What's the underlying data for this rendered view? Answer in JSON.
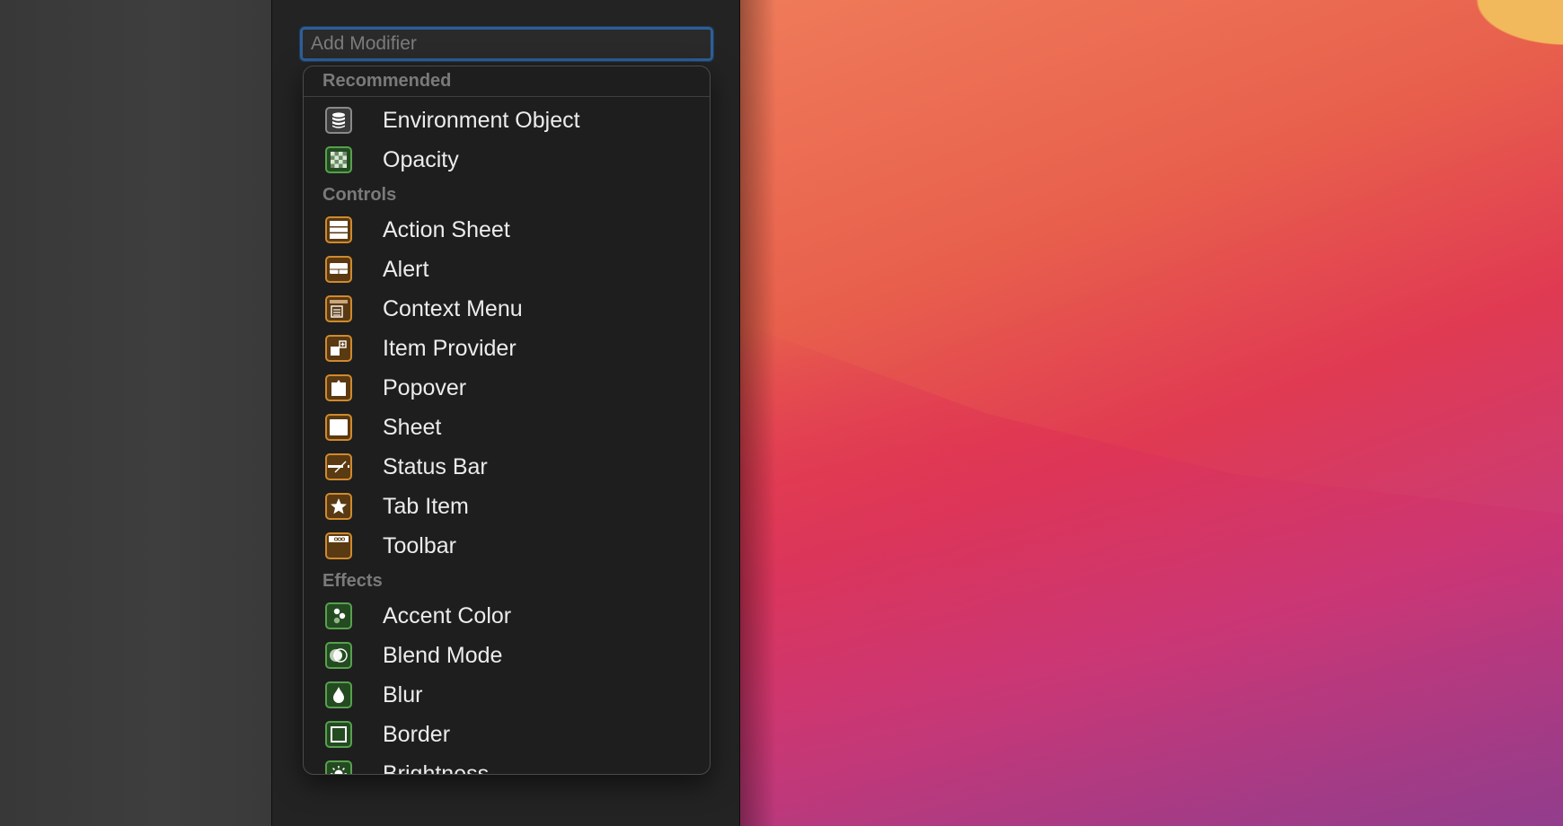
{
  "search": {
    "placeholder": "Add Modifier",
    "value": ""
  },
  "sections": [
    {
      "title": "Recommended",
      "items": [
        {
          "label": "Environment Object",
          "icon": "database-icon",
          "color": "gray"
        },
        {
          "label": "Opacity",
          "icon": "checkerboard-icon",
          "color": "green"
        }
      ]
    },
    {
      "title": "Controls",
      "items": [
        {
          "label": "Action Sheet",
          "icon": "action-sheet-icon",
          "color": "orange"
        },
        {
          "label": "Alert",
          "icon": "alert-icon",
          "color": "orange"
        },
        {
          "label": "Context Menu",
          "icon": "context-menu-icon",
          "color": "orange"
        },
        {
          "label": "Item Provider",
          "icon": "item-provider-icon",
          "color": "orange"
        },
        {
          "label": "Popover",
          "icon": "popover-icon",
          "color": "orange"
        },
        {
          "label": "Sheet",
          "icon": "sheet-icon",
          "color": "orange"
        },
        {
          "label": "Status Bar",
          "icon": "status-bar-icon",
          "color": "orange"
        },
        {
          "label": "Tab Item",
          "icon": "star-icon",
          "color": "orange"
        },
        {
          "label": "Toolbar",
          "icon": "toolbar-icon",
          "color": "orange"
        }
      ]
    },
    {
      "title": "Effects",
      "items": [
        {
          "label": "Accent Color",
          "icon": "accent-color-icon",
          "color": "green"
        },
        {
          "label": "Blend Mode",
          "icon": "blend-mode-icon",
          "color": "green"
        },
        {
          "label": "Blur",
          "icon": "drop-icon",
          "color": "green"
        },
        {
          "label": "Border",
          "icon": "border-icon",
          "color": "green"
        },
        {
          "label": "Brightness",
          "icon": "sun-icon",
          "color": "green"
        }
      ]
    }
  ],
  "colors": {
    "accent_focus": "#2f5f94",
    "gray_border": "#8a8a8a",
    "green_border": "#56a14c",
    "orange_border": "#d08a2c"
  }
}
